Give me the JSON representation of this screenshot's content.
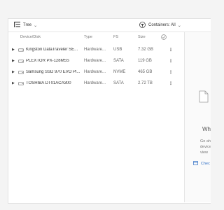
{
  "toolbar": {
    "view_label": "Tree",
    "containers_label": "Containers: All"
  },
  "table": {
    "headers": {
      "device": "Device/Disk",
      "type": "Type",
      "fs": "FS",
      "size": "Size"
    },
    "rows": [
      {
        "name": "Kingston DataTraveler SE...",
        "type": "Hardware...",
        "fs": "USB",
        "size": "7.32 GB"
      },
      {
        "name": "PLEXTOR PX-128M5S",
        "type": "Hardware...",
        "fs": "SATA",
        "size": "119 GB"
      },
      {
        "name": "Samsung SSD 970 EVO Pl...",
        "type": "Hardware...",
        "fs": "NVME",
        "size": "465 GB"
      },
      {
        "name": "TOSHIBA DT01ACA300",
        "type": "Hardware...",
        "fs": "SATA",
        "size": "2.72 TB"
      }
    ]
  },
  "side_panel": {
    "title": "Wh",
    "desc_line1": "Go ahead",
    "desc_line2": "device s",
    "desc_line3": "view",
    "link": "Chec"
  },
  "colors": {
    "link": "#2f6fc5",
    "border": "#e6e6e6"
  }
}
